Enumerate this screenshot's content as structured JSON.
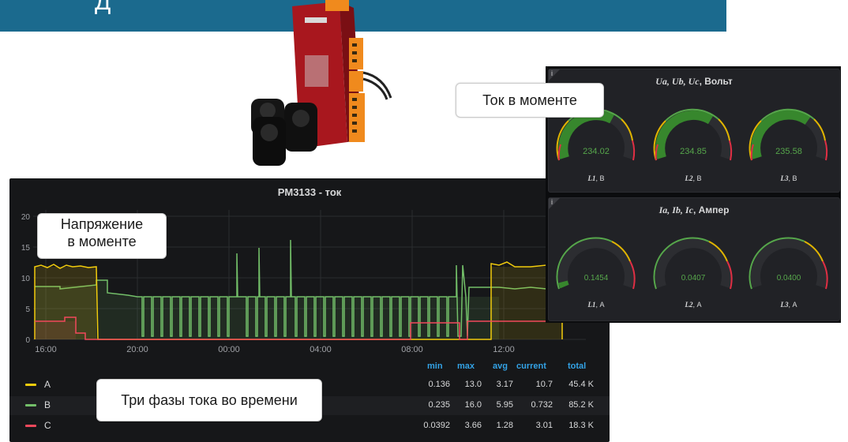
{
  "banner": {
    "title": "Д"
  },
  "graph": {
    "title": "PM3133 - ток",
    "y_ticks": [
      "20",
      "15",
      "10",
      "5",
      "0"
    ],
    "x_ticks": [
      "16:00",
      "20:00",
      "00:00",
      "04:00",
      "08:00",
      "12:00"
    ],
    "legend_headers": {
      "min": "min",
      "max": "max",
      "avg": "avg",
      "current": "current",
      "total": "total"
    },
    "series": [
      {
        "name": "A",
        "color": "#f2cc0c",
        "min": "0.136",
        "max": "13.0",
        "avg": "3.17",
        "current": "10.7",
        "total": "45.4 K"
      },
      {
        "name": "B",
        "color": "#73bf69",
        "min": "0.235",
        "max": "16.0",
        "avg": "5.95",
        "current": "0.732",
        "total": "85.2 K"
      },
      {
        "name": "C",
        "color": "#f2495c",
        "min": "0.0392",
        "max": "3.66",
        "avg": "1.28",
        "current": "3.01",
        "total": "18.3 K"
      }
    ]
  },
  "voltage_panel": {
    "title_vars": "Ua, Ub, Uc",
    "title_unit": ", Вольт",
    "gauges": [
      {
        "value": "234.02",
        "label_var": "L1",
        "label_unit": ", В",
        "fraction": 0.6
      },
      {
        "value": "234.85",
        "label_var": "L2",
        "label_unit": ", В",
        "fraction": 0.62
      },
      {
        "value": "235.58",
        "label_var": "L3",
        "label_unit": ", В",
        "fraction": 0.64
      }
    ]
  },
  "current_panel": {
    "title_vars": "Ia, Ib, Ic",
    "title_unit": ", Ампер",
    "gauges": [
      {
        "value": "0.1454",
        "label_var": "L1",
        "label_unit": ", А",
        "fraction": 0.04
      },
      {
        "value": "0.0407",
        "label_var": "L2",
        "label_unit": ", А",
        "fraction": 0.01
      },
      {
        "value": "0.0400",
        "label_var": "L3",
        "label_unit": ", А",
        "fraction": 0.01
      }
    ]
  },
  "annotations": {
    "current_now": "Ток в моменте",
    "voltage_now_line1": "Напряжение",
    "voltage_now_line2": "в моменте",
    "three_phases": "Три фазы тока во времени"
  }
}
